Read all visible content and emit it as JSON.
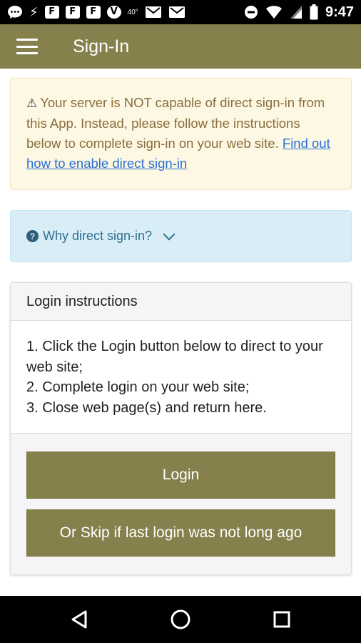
{
  "status_bar": {
    "notification_icons": [
      "F",
      "F",
      "F"
    ],
    "v_icon": "V",
    "temperature": "40°",
    "time": "9:47"
  },
  "app_bar": {
    "title": "Sign-In"
  },
  "warning": {
    "text": "Your server is NOT capable of direct sign-in from this App. Instead, please follow the instructions below to complete sign-in on your web site.",
    "link": "Find out how to enable direct sign-in"
  },
  "info": {
    "label": "Why direct sign-in?"
  },
  "panel": {
    "heading": "Login instructions",
    "steps": [
      "1. Click the Login button below to direct to your web site;",
      "2. Complete login on your web site;",
      "3. Close web page(s) and return here."
    ],
    "login_label": "Login",
    "skip_label": "Or Skip if last login was not long ago"
  },
  "colors": {
    "accent": "#86804c",
    "warning_bg": "#fcf8e3",
    "warning_text": "#8a6d3b",
    "info_bg": "#d9edf7",
    "info_text": "#31708f",
    "link": "#2a6fd6"
  }
}
